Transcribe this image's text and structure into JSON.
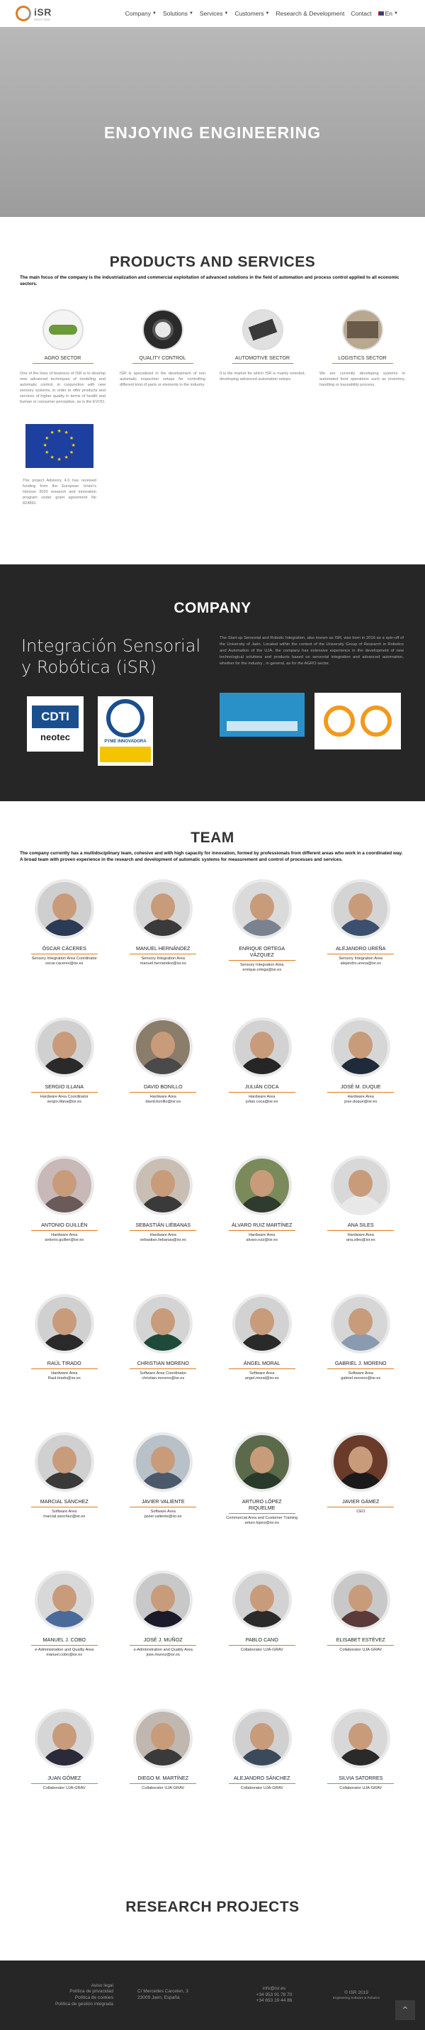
{
  "nav": {
    "logo_text": "iSR",
    "logo_sub": "ENJOY ENG",
    "items": [
      {
        "label": "Company",
        "dropdown": true
      },
      {
        "label": "Solutions",
        "dropdown": true
      },
      {
        "label": "Services",
        "dropdown": true
      },
      {
        "label": "Customers",
        "dropdown": true
      },
      {
        "label": "Research & Development",
        "dropdown": false
      },
      {
        "label": "Contact",
        "dropdown": false
      },
      {
        "label": "En",
        "dropdown": true
      }
    ]
  },
  "hero": {
    "title": "ENJOYING ENGINEERING"
  },
  "products": {
    "title": "PRODUCTS AND SERVICES",
    "lead": "The main focus of the company is the industrialization and commercial exploitation of advanced solutions in the field of automation and process control applied to all economic sectors.",
    "items": [
      {
        "label": "AGRO SECTOR",
        "text": "One of the lines of business of ISR is to develop new advanced techniques of modeling and automatic control, in conjunction with new sensory systems, in order to offer products and services of higher quality in terms of health and human or consumer perception, as is the EVOO."
      },
      {
        "label": "QUALITY CONTROL",
        "text": "ISR is specialized in the development of non automatic inspection setups for controlling different kind of parts or elements in the industry."
      },
      {
        "label": "AUTOMOTIVE SECTOR",
        "text": "It is the market for which ISR is mainly oriented, developing advanced automation setups."
      },
      {
        "label": "LOGISTICS SECTOR",
        "text": "We are currently developing systems in automated food operations such as inventory, handling or traceability process."
      }
    ],
    "eu_text": "The project Advisory 4.0 has received funding from the European Union's Horizon 2020 research and innovation program under grant agreement No 824891."
  },
  "company": {
    "title": "COMPANY",
    "big_text": "Integración Sensorial y Robótica (iSR)",
    "text": "The Start-up Sensorial and Robotic Integration, also known as ISR, was born in 2016 as a spin-off of the University of Jaén. Located within the context of the University Group of Research in Robotics and Automation of the UJA, the company has extensive experience in the development of new technological solutions and products based on sensorial integration and advanced automation, whether for the industry , in general, as for the AGRO sector.",
    "cdti_top": "CDTI",
    "cdti_bottom": "neotec",
    "pyme_text": "PYME INNOVADORA"
  },
  "team": {
    "title": "TEAM",
    "lead": "The company currently has a multidisciplinary team, cohesive and with high capacity for innovation, formed by professionals from different areas who work in a coordinated way. A broad team with proven experience in the research and development of automatic systems for measurement and control of processes and services.",
    "members": [
      {
        "name": "ÓSCAR CÁCERES",
        "role": "Sensory Integration Area Coordinator",
        "email": "oscar.caceres@isr.es",
        "shirt": "#2b3a55",
        "bg": "#cfcfcf"
      },
      {
        "name": "MANUEL HERNÁNDEZ",
        "role": "Sensory Integration Area",
        "email": "manuel.hernandez@isr.es",
        "shirt": "#3a3a3a",
        "bg": "#d6d6d6"
      },
      {
        "name": "ENRIQUE ORTEGA VÁZQUEZ",
        "role": "Sensory Integration Area",
        "email": "enrique.ortega@isr.es",
        "shirt": "#7a8290",
        "bg": "#dadada"
      },
      {
        "name": "ALEJANDRO UREÑA",
        "role": "Sensory Integration Area",
        "email": "alejandro.urena@isr.es",
        "shirt": "#3c4f6e",
        "bg": "#d4d4d4"
      },
      {
        "name": "SERGIO ILLANA",
        "role": "Hardware Area Coordinator",
        "email": "sergio.illana@isr.es",
        "shirt": "#2a2a2a",
        "bg": "#d0d0d0"
      },
      {
        "name": "DAVID BONILLO",
        "role": "Hardware Area",
        "email": "david.bonillo@isr.es",
        "shirt": "#4a4a4a",
        "bg": "#8a7d6a"
      },
      {
        "name": "JULIÁN COCA",
        "role": "Hardware Area",
        "email": "julian.coca@isr.es",
        "shirt": "#262626",
        "bg": "#d2d2d2"
      },
      {
        "name": "JOSÉ M. DUQUE",
        "role": "Hardware Area",
        "email": "jose.duque@isr.es",
        "shirt": "#1f2a3a",
        "bg": "#d6d6d6"
      },
      {
        "name": "ANTONIO GUILLÉN",
        "role": "Hardware Area",
        "email": "antonio.guillen@isr.es",
        "shirt": "#6a5a5a",
        "bg": "#c9b8b8"
      },
      {
        "name": "SEBASTIÁN LIÉBANAS",
        "role": "Hardware Area",
        "email": "sebastian.liebanas@isr.es",
        "shirt": "#3a3a3a",
        "bg": "#c8beb4"
      },
      {
        "name": "ÁLVARO RUIZ MARTÍNEZ",
        "role": "Hardware Area",
        "email": "alvaro.ruiz@isr.es",
        "shirt": "#2e3b2e",
        "bg": "#7a8a5a"
      },
      {
        "name": "ANA SILES",
        "role": "Hardware Area",
        "email": "ana.siles@isr.es",
        "shirt": "#e8e8e8",
        "bg": "#d8d8d8"
      },
      {
        "name": "RAÚL TIRADO",
        "role": "Hardware Area",
        "email": "Raul.tirado@isr.es",
        "shirt": "#2a2a2a",
        "bg": "#d0d0d0"
      },
      {
        "name": "CHRISTIAN MORENO",
        "role": "Software Area Coordinator",
        "email": "christian.moreno@isr.es",
        "shirt": "#1e4a3a",
        "bg": "#d4d4d4"
      },
      {
        "name": "ÁNGEL MORAL",
        "role": "Software Area",
        "email": "angel.moral@isr.es",
        "shirt": "#2a2a2a",
        "bg": "#d2d2d2"
      },
      {
        "name": "GABRIEL J. MORENO",
        "role": "Software Area",
        "email": "gabriel.moreno@isr.es",
        "shirt": "#8a9ab0",
        "bg": "#d6d6d6"
      },
      {
        "name": "MARCIAL SÁNCHEZ",
        "role": "Software Area",
        "email": "marcial.sanchez@isr.es",
        "shirt": "#3a3a3a",
        "bg": "#d0d0d0"
      },
      {
        "name": "JAVIER VALIENTE",
        "role": "Software Area",
        "email": "javier.valiente@isr.es",
        "shirt": "#4a5a6a",
        "bg": "#b8c0c8"
      },
      {
        "name": "ARTURO LÓPEZ RIQUELME",
        "role": "Commercial Area and Customer Training",
        "email": "arturo.lopez@isr.es",
        "shirt": "#2a3a2a",
        "bg": "#5a6a4a"
      },
      {
        "name": "JAVIER GÁMEZ",
        "role": "CEO",
        "email": "",
        "shirt": "#1a1a1a",
        "bg": "#6a3a2a"
      },
      {
        "name": "MANUEL J. COBO",
        "role": "e-Administration and Quality Area",
        "email": "manuel.cobo@isr.es",
        "shirt": "#4a6a9a",
        "bg": "#d8d8d8"
      },
      {
        "name": "JOSÉ J. MUÑOZ",
        "role": "e-Administration and Quality Area",
        "email": "jose.munoz@isr.es",
        "shirt": "#1a1a2a",
        "bg": "#c8c8c8"
      },
      {
        "name": "PABLO CANO",
        "role": "Collaborator UJA-GRAV",
        "email": "",
        "shirt": "#2a2a2a",
        "bg": "#d2d2d2"
      },
      {
        "name": "ELISABET ESTÉVEZ",
        "role": "Collaborator UJA-GRAV",
        "email": "",
        "shirt": "#5a3a3a",
        "bg": "#c8c8c8"
      },
      {
        "name": "JUAN GÓMEZ",
        "role": "Collaborator UJA-GRAV",
        "email": "",
        "shirt": "#2a2a3a",
        "bg": "#d6d6d6"
      },
      {
        "name": "DIEGO M. MARTÍNEZ",
        "role": "Collaborator UJA-GRAV",
        "email": "",
        "shirt": "#3a3a3a",
        "bg": "#c0b8b0"
      },
      {
        "name": "ALEJANDRO SÁNCHEZ",
        "role": "Collaborator UJA-GRAV",
        "email": "",
        "shirt": "#3a4a5a",
        "bg": "#d0d0d0"
      },
      {
        "name": "SILVIA SATORRES",
        "role": "Collaborator UJA-GRAV",
        "email": "",
        "shirt": "#2a2a2a",
        "bg": "#d8d8d8"
      }
    ]
  },
  "research": {
    "title": "RESEARCH PROJECTS"
  },
  "footer": {
    "col1": [
      "Aviso legal",
      "Política de privacidad",
      "Política de cookies",
      "Política de gestión integrada"
    ],
    "col2": [
      "C/ Mercedes Carcelen, 3",
      "23009 Jaén, España"
    ],
    "col3": [
      "info@isr.es",
      "+34 953 91 78 70",
      "+34 653 19 44 86"
    ],
    "col4": [
      "© ISR 2019",
      "Engineering Software & Robotics"
    ]
  },
  "colors": {
    "accent": "#e07b1a",
    "dark": "#262626"
  }
}
